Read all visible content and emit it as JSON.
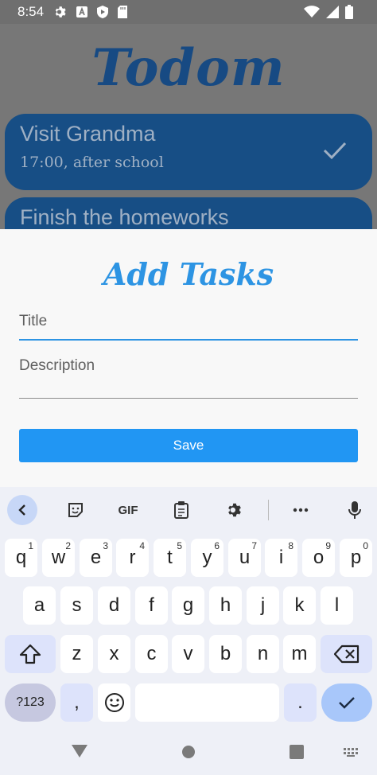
{
  "status": {
    "time": "8:54"
  },
  "app": {
    "title": "Todom",
    "tasks": [
      {
        "title": "Visit Grandma",
        "subtitle": "17:00, after school"
      },
      {
        "title": "Finish the homeworks"
      }
    ]
  },
  "sheet": {
    "title": "Add Tasks",
    "title_placeholder": "Title",
    "description_placeholder": "Description",
    "save_label": "Save"
  },
  "keyboard": {
    "gif_label": "GIF",
    "row1": [
      {
        "key": "q",
        "hint": "1"
      },
      {
        "key": "w",
        "hint": "2"
      },
      {
        "key": "e",
        "hint": "3"
      },
      {
        "key": "r",
        "hint": "4"
      },
      {
        "key": "t",
        "hint": "5"
      },
      {
        "key": "y",
        "hint": "6"
      },
      {
        "key": "u",
        "hint": "7"
      },
      {
        "key": "i",
        "hint": "8"
      },
      {
        "key": "o",
        "hint": "9"
      },
      {
        "key": "p",
        "hint": "0"
      }
    ],
    "row2": [
      "a",
      "s",
      "d",
      "f",
      "g",
      "h",
      "j",
      "k",
      "l"
    ],
    "row3": [
      "z",
      "x",
      "c",
      "v",
      "b",
      "n",
      "m"
    ],
    "symbols_label": "?123",
    "comma": ",",
    "period": "."
  },
  "colors": {
    "accent": "#2196f3",
    "card": "#174e85",
    "sheet_title": "#2d94e3"
  }
}
